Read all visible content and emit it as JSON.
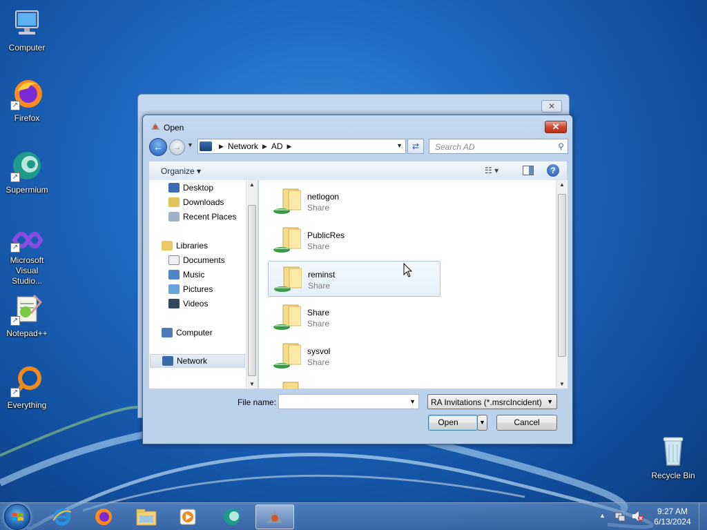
{
  "desktop": {
    "icons": [
      {
        "label": "Computer"
      },
      {
        "label": "Firefox"
      },
      {
        "label": "Supermium"
      },
      {
        "label": "Microsoft Visual Studio..."
      },
      {
        "label": "Notepad++"
      },
      {
        "label": "Everything"
      },
      {
        "label": "Recycle Bin"
      }
    ]
  },
  "dialog": {
    "title": "Open",
    "close_label": "✕",
    "address": {
      "segments": [
        "Network",
        "AD"
      ]
    },
    "search_placeholder": "Search AD",
    "toolbar": {
      "organize_label": "Organize ▾",
      "help_label": "?"
    },
    "nav_items": [
      {
        "label": "Desktop"
      },
      {
        "label": "Downloads"
      },
      {
        "label": "Recent Places"
      },
      {
        "label": "Libraries"
      },
      {
        "label": "Documents"
      },
      {
        "label": "Music"
      },
      {
        "label": "Pictures"
      },
      {
        "label": "Videos"
      },
      {
        "label": "Computer"
      },
      {
        "label": "Network"
      }
    ],
    "files": [
      {
        "name": "netlogon",
        "type": "Share"
      },
      {
        "name": "PublicRes",
        "type": "Share"
      },
      {
        "name": "reminst",
        "type": "Share"
      },
      {
        "name": "Share",
        "type": "Share"
      },
      {
        "name": "sysvol",
        "type": "Share"
      }
    ],
    "file_name_label": "File name:",
    "file_name_value": "",
    "file_type": "RA Invitations (*.msrcIncident)",
    "open_label": "Open",
    "cancel_label": "Cancel"
  },
  "taskbar": {
    "time": "9:27 AM",
    "date": "6/13/2024"
  },
  "colors": {
    "desktop": "#1f6ac4",
    "selection": "#e6f0fb",
    "close": "#cc4b33"
  }
}
